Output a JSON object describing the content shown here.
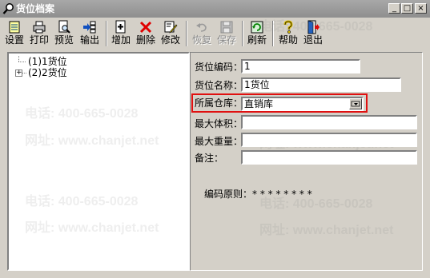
{
  "window": {
    "title": "货位档案",
    "controls": {
      "minimize": "_",
      "maximize": "□",
      "close": "×"
    }
  },
  "toolbar": {
    "buttons": [
      {
        "label": "设置",
        "icon": "settings-icon",
        "enabled": true
      },
      {
        "label": "打印",
        "icon": "printer-icon",
        "enabled": true
      },
      {
        "label": "预览",
        "icon": "preview-icon",
        "enabled": true
      },
      {
        "label": "输出",
        "icon": "export-icon",
        "enabled": true
      },
      {
        "label": "增加",
        "icon": "add-icon",
        "enabled": true
      },
      {
        "label": "删除",
        "icon": "delete-icon",
        "enabled": true
      },
      {
        "label": "修改",
        "icon": "edit-icon",
        "enabled": true
      },
      {
        "label": "恢复",
        "icon": "undo-icon",
        "enabled": false
      },
      {
        "label": "保存",
        "icon": "save-icon",
        "enabled": false
      },
      {
        "label": "刷新",
        "icon": "refresh-icon",
        "enabled": true
      },
      {
        "label": "帮助",
        "icon": "help-icon",
        "enabled": true
      },
      {
        "label": "退出",
        "icon": "exit-icon",
        "enabled": true
      }
    ]
  },
  "tree": {
    "items": [
      {
        "label": "(1)1货位",
        "expandable": false
      },
      {
        "label": "(2)2货位",
        "expandable": true,
        "expander": "+"
      }
    ]
  },
  "form": {
    "code_label": "货位编码：",
    "code_value": "1",
    "name_label": "货位名称：",
    "name_value": "1货位",
    "warehouse_label": "所属仓库：",
    "warehouse_value": "直销库",
    "max_volume_label": "最大体积：",
    "max_volume_value": "",
    "max_weight_label": "最大重量：",
    "max_weight_value": "",
    "note_label": "备注：",
    "note_value": "",
    "rule_text": "编码原则：* * * * * * * *"
  },
  "watermark": {
    "phone": "电话: 400-665-0028",
    "site": "网址: www.chanjet.net"
  },
  "colors": {
    "highlight": "#e01010",
    "titlebar": "#8e8e8e",
    "face": "#d4d0c8"
  }
}
